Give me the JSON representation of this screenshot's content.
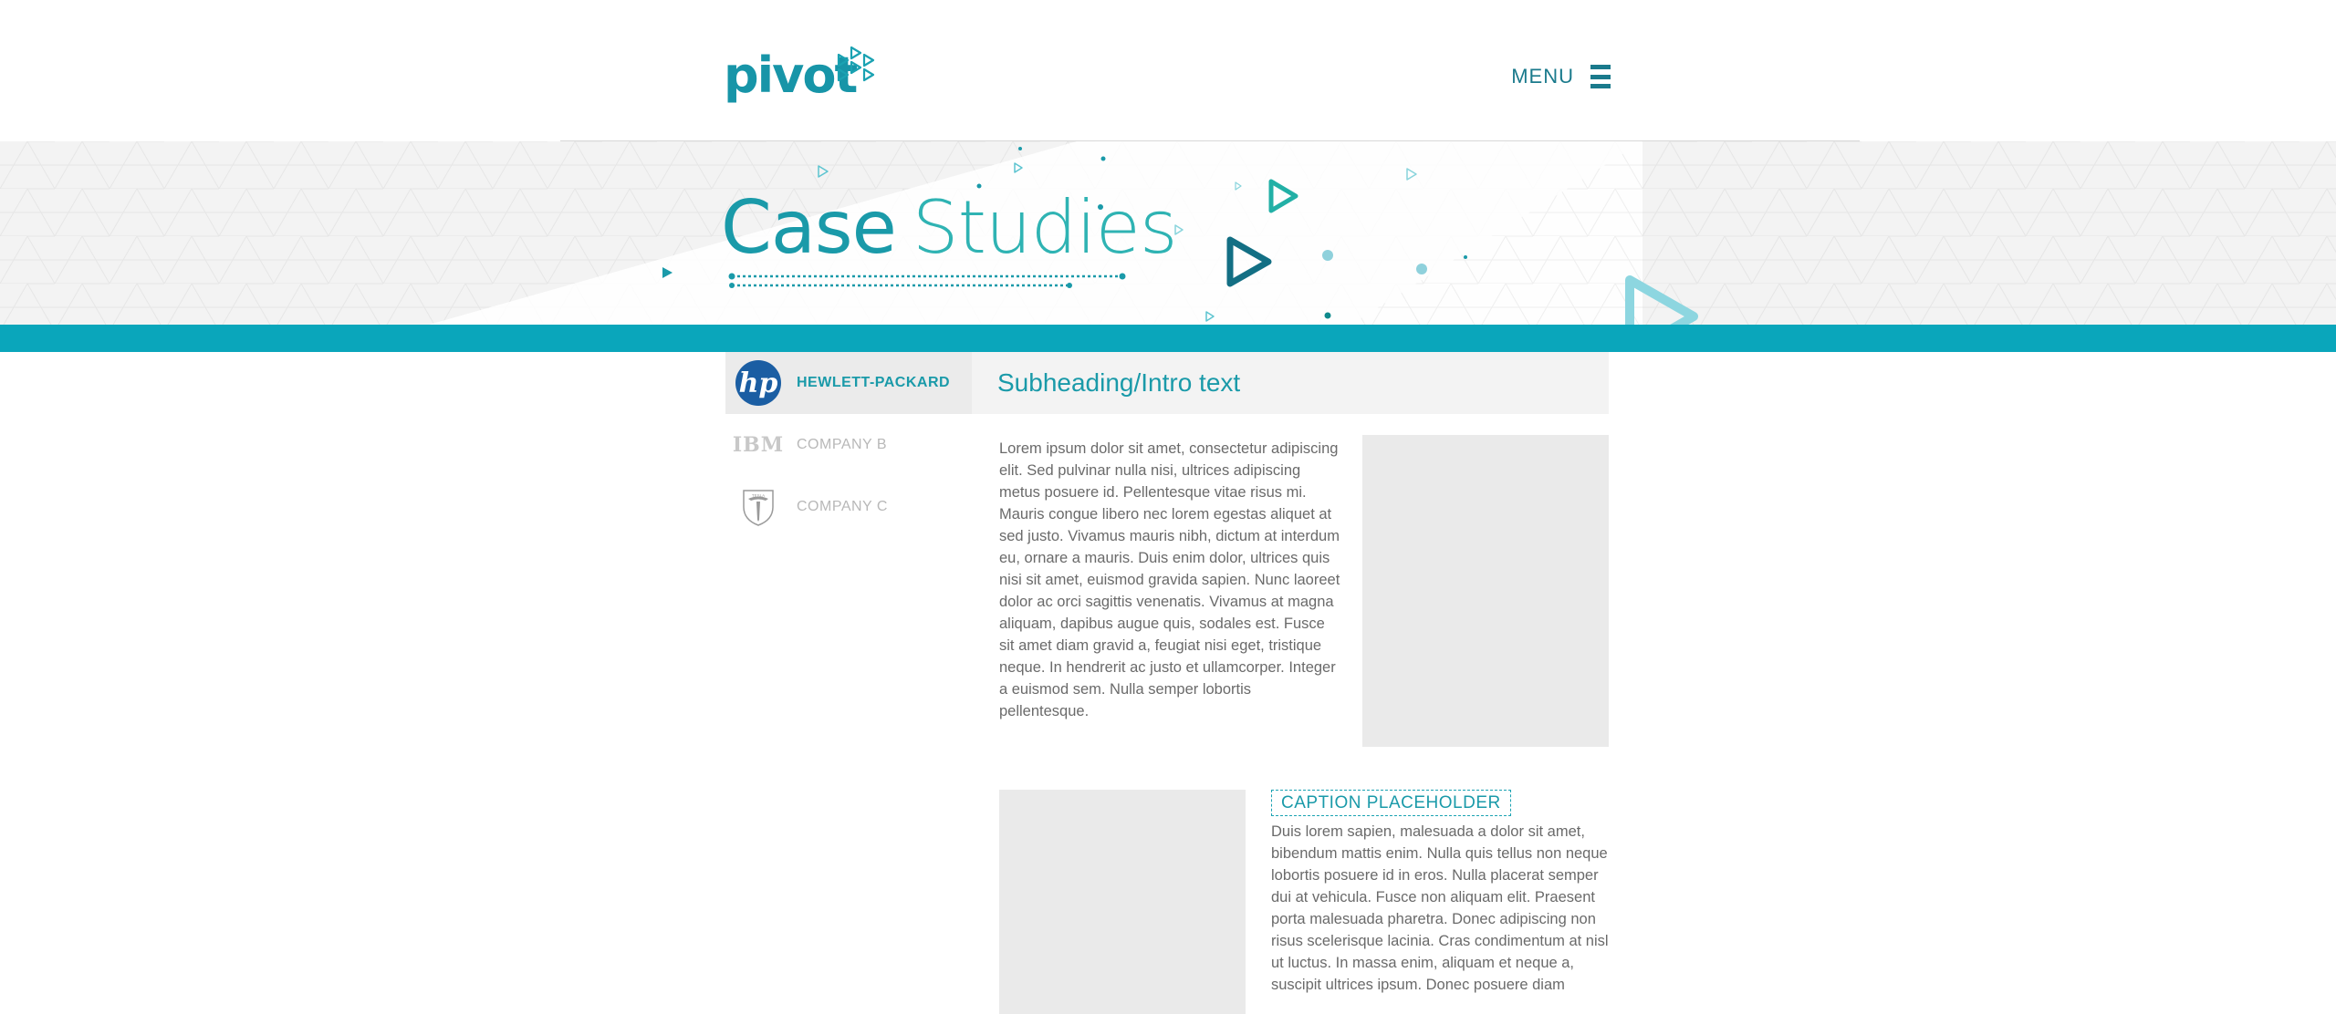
{
  "header": {
    "logo_text": "pivot",
    "menu_label": "MENU"
  },
  "hero": {
    "title_word1": "Case",
    "title_word2": "Studies"
  },
  "sidebar": {
    "items": [
      {
        "label": "HEWLETT-PACKARD",
        "logo_text": "hp",
        "active": true
      },
      {
        "label": "COMPANY B",
        "logo_text": "IBM",
        "active": false
      },
      {
        "label": "COMPANY C",
        "logo_text": "TESLA",
        "active": false
      }
    ]
  },
  "main": {
    "subheading": "Subheading/Intro text",
    "paragraph1": "Lorem ipsum dolor sit amet, consectetur adipiscing elit. Sed pulvinar nulla nisi, ultrices adipiscing metus posuere id. Pellentesque vitae risus mi. Mauris congue libero nec lorem egestas aliquet at sed justo. Vivamus mauris nibh, dictum at interdum eu, ornare a mauris. Duis enim dolor, ultrices quis nisi sit amet, euismod gravida sapien. Nunc laoreet dolor ac orci sagittis venenatis. Vivamus at magna aliquam, dapibus augue quis, sodales est. Fusce sit amet diam gravid a, feugiat nisi eget, tristique neque. In hendrerit ac justo et ullamcorper. Integer a euismod sem. Nulla semper lobortis pellentesque.",
    "caption": "CAPTION PLACEHOLDER",
    "paragraph2": "Duis lorem sapien, malesuada a dolor sit amet, bibendum mattis enim. Nulla quis tellus non neque lobortis posuere id in eros. Nulla placerat semper dui at vehicula. Fusce non aliquam elit. Praesent porta malesuada pharetra. Donec adipiscing non risus scelerisque lacinia. Cras condimentum at nisl ut luctus. In massa enim, aliquam et neque a, suscipit ultrices ipsum. Donec posuere diam"
  },
  "colors": {
    "brand_teal": "#1a9aa9",
    "accent_bar": "#0aa6bb",
    "dark_teal": "#1a7a8c",
    "hp_blue": "#1b5ea3"
  }
}
